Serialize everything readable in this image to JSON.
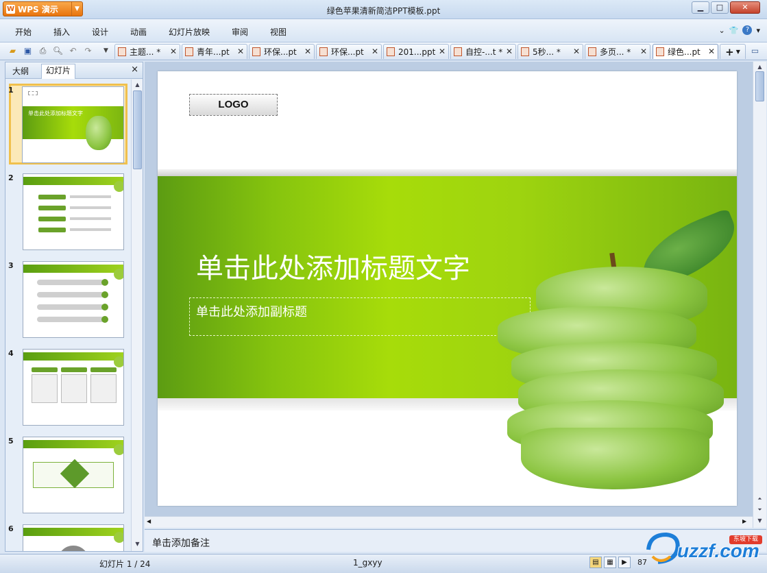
{
  "app": {
    "name": "WPS 演示",
    "title": "绿色苹果清新简洁PPT模板.ppt"
  },
  "window_controls": {
    "minimize": "▁",
    "maximize": "□",
    "close": "✕"
  },
  "menu": {
    "items": [
      "开始",
      "插入",
      "设计",
      "动画",
      "幻灯片放映",
      "审阅",
      "视图"
    ]
  },
  "tabs": [
    {
      "label": "主题... *"
    },
    {
      "label": "青年...pt"
    },
    {
      "label": "环保...pt"
    },
    {
      "label": "环保...pt"
    },
    {
      "label": "201...ppt"
    },
    {
      "label": "自控-...t *"
    },
    {
      "label": "5秒... *"
    },
    {
      "label": "多页... *"
    },
    {
      "label": "绿色...pt",
      "active": true
    }
  ],
  "new_tab": "+",
  "left_panel": {
    "tabs": [
      "大纲",
      "幻灯片"
    ],
    "active_tab": "幻灯片",
    "close": "×",
    "thumbnails": [
      "1",
      "2",
      "3",
      "4",
      "5",
      "6"
    ],
    "thumb1_title": "单击此处添加标题文字"
  },
  "slide": {
    "logo": "LOGO",
    "title": "单击此处添加标题文字",
    "subtitle": "单击此处添加副标题"
  },
  "notes": {
    "placeholder": "单击添加备注"
  },
  "status": {
    "slide_count": "幻灯片 1 / 24",
    "theme": "1_gxyy",
    "zoom": "87"
  },
  "watermark": {
    "text": "uzzf.com",
    "badge": "东坡下载"
  },
  "colors": {
    "accent_orange": "#e8740e",
    "slide_green": "#9ed40f"
  }
}
